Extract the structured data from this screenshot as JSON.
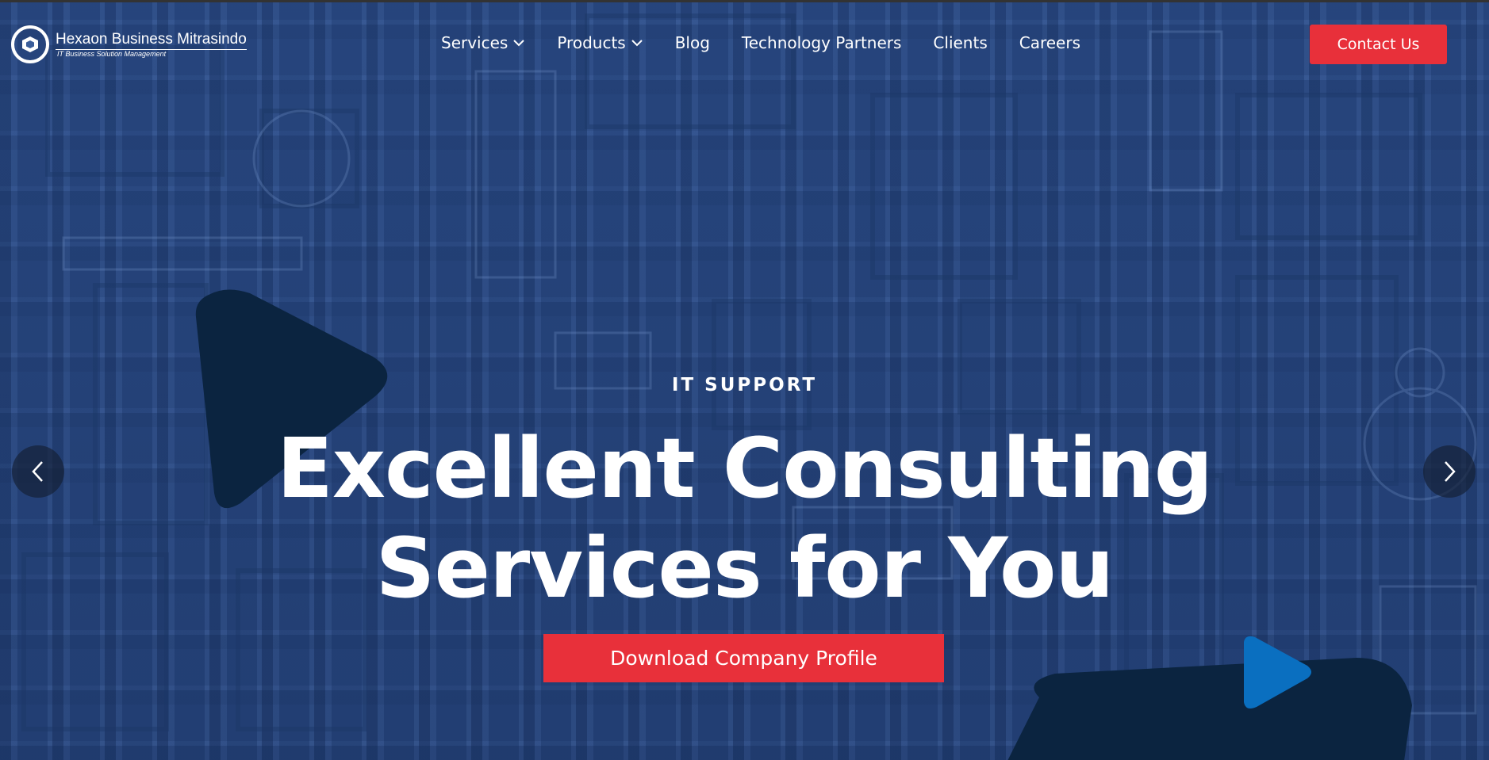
{
  "brand": {
    "name": "Hexaon Business Mitrasindo",
    "tagline": "IT Business Solution Management"
  },
  "nav": {
    "items": [
      {
        "label": "Services",
        "has_dropdown": true
      },
      {
        "label": "Products",
        "has_dropdown": true
      },
      {
        "label": "Blog",
        "has_dropdown": false
      },
      {
        "label": "Technology Partners",
        "has_dropdown": false
      },
      {
        "label": "Clients",
        "has_dropdown": false
      },
      {
        "label": "Careers",
        "has_dropdown": false
      }
    ],
    "contact_label": "Contact Us"
  },
  "hero": {
    "kicker": "IT SUPPORT",
    "headline_line1": "Excellent Consulting",
    "headline_line2": "Services for You",
    "cta_label": "Download Company Profile"
  },
  "colors": {
    "accent": "#e8303a",
    "overlay": "#2f4f86",
    "shape_dark": "#0b2440",
    "shape_blue": "#0a6fc0"
  },
  "icons": {
    "prev": "chevron-left-icon",
    "next": "chevron-right-icon",
    "dropdown": "chevron-down-icon"
  }
}
